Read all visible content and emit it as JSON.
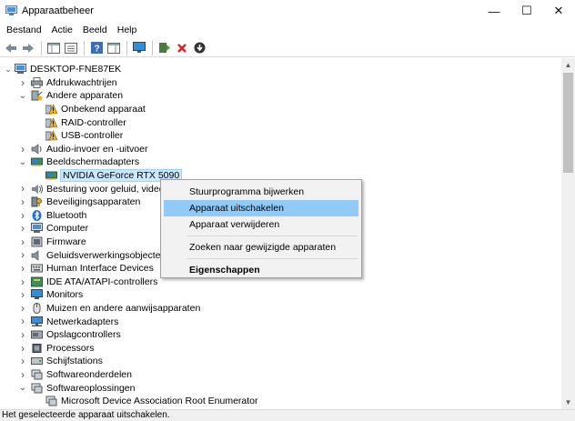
{
  "window": {
    "title": "Apparaatbeheer",
    "icon": "device-manager-icon",
    "controls": {
      "minimize": "—",
      "maximize": "☐",
      "close": "✕"
    }
  },
  "menu": [
    "Bestand",
    "Actie",
    "Beeld",
    "Help"
  ],
  "toolbar": {
    "buttons": [
      "back-icon",
      "forward-icon",
      "show-hide-tree-icon",
      "properties-icon",
      "help-icon",
      "action-pane-icon",
      "monitor-icon",
      "update-driver-icon",
      "uninstall-icon",
      "download-icon"
    ]
  },
  "tree": {
    "root": "DESKTOP-FNE87EK",
    "items": [
      {
        "label": "Afdrukwachtrijen",
        "level": 1,
        "expander": "collapsed",
        "icon": "printer-icon"
      },
      {
        "label": "Andere apparaten",
        "level": 1,
        "expander": "expanded",
        "icon": "unknown-device-icon"
      },
      {
        "label": "Onbekend apparaat",
        "level": 2,
        "expander": "none",
        "icon": "warning-icon"
      },
      {
        "label": "RAID-controller",
        "level": 2,
        "expander": "none",
        "icon": "warning-icon"
      },
      {
        "label": "USB-controller",
        "level": 2,
        "expander": "none",
        "icon": "warning-icon"
      },
      {
        "label": "Audio-invoer en -uitvoer",
        "level": 1,
        "expander": "collapsed",
        "icon": "speaker-icon"
      },
      {
        "label": "Beeldschermadapters",
        "level": 1,
        "expander": "expanded",
        "icon": "display-adapter-icon"
      },
      {
        "label": "NVIDIA GeForce RTX 5090",
        "level": 2,
        "expander": "none",
        "icon": "display-adapter-icon",
        "selected": true
      },
      {
        "label": "Besturing voor geluid, video e",
        "level": 1,
        "expander": "collapsed",
        "icon": "sound-icon"
      },
      {
        "label": "Beveiligingsapparaten",
        "level": 1,
        "expander": "collapsed",
        "icon": "security-key-icon"
      },
      {
        "label": "Bluetooth",
        "level": 1,
        "expander": "collapsed",
        "icon": "bluetooth-icon"
      },
      {
        "label": "Computer",
        "level": 1,
        "expander": "collapsed",
        "icon": "computer-icon"
      },
      {
        "label": "Firmware",
        "level": 1,
        "expander": "collapsed",
        "icon": "firmware-icon"
      },
      {
        "label": "Geluidsverwerkingsobjecten (",
        "level": 1,
        "expander": "collapsed",
        "icon": "audio-processing-icon"
      },
      {
        "label": "Human Interface Devices",
        "level": 1,
        "expander": "collapsed",
        "icon": "hid-icon"
      },
      {
        "label": "IDE ATA/ATAPI-controllers",
        "level": 1,
        "expander": "collapsed",
        "icon": "ide-icon"
      },
      {
        "label": "Monitors",
        "level": 1,
        "expander": "collapsed",
        "icon": "monitor-icon"
      },
      {
        "label": "Muizen en andere aanwijsapparaten",
        "level": 1,
        "expander": "collapsed",
        "icon": "mouse-icon"
      },
      {
        "label": "Netwerkadapters",
        "level": 1,
        "expander": "collapsed",
        "icon": "network-icon"
      },
      {
        "label": "Opslagcontrollers",
        "level": 1,
        "expander": "collapsed",
        "icon": "storage-icon"
      },
      {
        "label": "Processors",
        "level": 1,
        "expander": "collapsed",
        "icon": "cpu-icon"
      },
      {
        "label": "Schijfstations",
        "level": 1,
        "expander": "collapsed",
        "icon": "disk-icon"
      },
      {
        "label": "Softwareonderdelen",
        "level": 1,
        "expander": "collapsed",
        "icon": "software-component-icon"
      },
      {
        "label": "Softwareoplossingen",
        "level": 1,
        "expander": "expanded",
        "icon": "software-device-icon"
      },
      {
        "label": "Microsoft Device Association Root Enumerator",
        "level": 2,
        "expander": "none",
        "icon": "software-device-icon"
      }
    ]
  },
  "context_menu": {
    "items": [
      {
        "label": "Stuurprogramma bijwerken",
        "separator_after": false
      },
      {
        "label": "Apparaat uitschakelen",
        "highlighted": true,
        "separator_after": false
      },
      {
        "label": "Apparaat verwijderen",
        "separator_after": true
      },
      {
        "label": "Zoeken naar gewijzigde apparaten",
        "separator_after": true
      },
      {
        "label": "Eigenschappen",
        "bold": true,
        "separator_after": false
      }
    ]
  },
  "status_text": "Het geselecteerde apparaat uitschakelen.",
  "colors": {
    "selection": "#cce8ff",
    "menu_highlight": "#91c9f7",
    "warning": "#f5b400",
    "error": "#d8262c"
  }
}
